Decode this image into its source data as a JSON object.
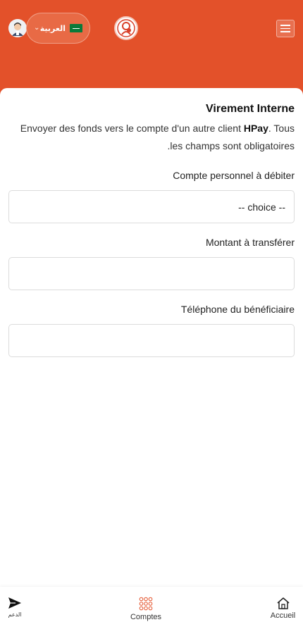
{
  "header": {
    "language_label": "العربية",
    "flag_icon": "saudi-flag-icon",
    "logo_icon": "brand-logo-icon",
    "menu_icon": "hamburger-menu-icon",
    "accent_color": "#e3512a"
  },
  "form": {
    "title": "Virement Interne",
    "description_pre": "Envoyer des fonds vers le compte d'un autre client ",
    "description_brand": "HPay",
    "description_post": ". Tous les champs sont obligatoires.",
    "account_label": "Compte personnel à débiter",
    "account_selected": "-- choice --",
    "amount_label": "Montant à transférer",
    "amount_value": "",
    "phone_label": "Téléphone du bénéficiaire",
    "phone_value": ""
  },
  "bottom_nav": {
    "support_label": "الدعم",
    "comptes_label": "Comptes",
    "accueil_label": "Accueil"
  }
}
